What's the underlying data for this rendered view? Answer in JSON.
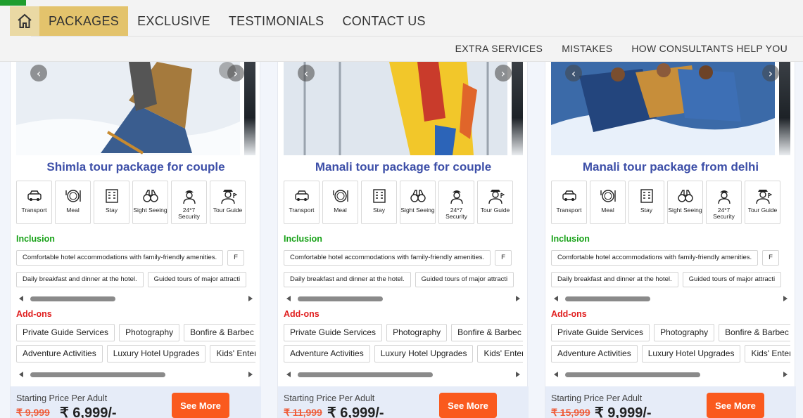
{
  "nav": {
    "home_icon": "home-icon",
    "primary": [
      "PACKAGES",
      "EXCLUSIVE",
      "TESTIMONIALS",
      "CONTACT US"
    ],
    "active": "PACKAGES",
    "secondary": [
      "EXTRA SERVICES",
      "MISTAKES",
      "HOW CONSULTANTS HELP YOU"
    ]
  },
  "colors": {
    "accent_active": "#e3c36c",
    "title_blue": "#3d4fa8",
    "inclusion_green": "#16a116",
    "addons_red": "#e01f1f",
    "cta_orange": "#fa5a1e"
  },
  "features": [
    {
      "icon": "car-icon",
      "label": "Transport"
    },
    {
      "icon": "meal-icon",
      "label": "Meal"
    },
    {
      "icon": "hotel-icon",
      "label": "Stay"
    },
    {
      "icon": "binoculars-icon",
      "label": "Sight Seeing"
    },
    {
      "icon": "guard-icon",
      "label": "24*7 Security"
    },
    {
      "icon": "tour-guide-icon",
      "label": "Tour Guide"
    }
  ],
  "cards": [
    {
      "title": "Shimla tour package for couple",
      "inclusion_heading": "Inclusion",
      "inclusions_row1": [
        "Comfortable hotel accommodations with family-friendly amenities.",
        "F"
      ],
      "inclusions_row2": [
        "Daily breakfast and dinner at the hotel.",
        "Guided tours of major attracti"
      ],
      "addons_heading": "Add-ons",
      "addons_row1": [
        "Private Guide Services",
        "Photography",
        "Bonfire & Barbec"
      ],
      "addons_row2": [
        "Adventure Activities",
        "Luxury Hotel Upgrades",
        "Kids' Enter"
      ],
      "price_label": "Starting Price Per Adult",
      "old_price": "₹ 9,999",
      "new_price": "₹ 6,999/-",
      "cta": "See More"
    },
    {
      "title": "Manali tour package for couple",
      "inclusion_heading": "Inclusion",
      "inclusions_row1": [
        "Comfortable hotel accommodations with family-friendly amenities.",
        "F"
      ],
      "inclusions_row2": [
        "Daily breakfast and dinner at the hotel.",
        "Guided tours of major attracti"
      ],
      "addons_heading": "Add-ons",
      "addons_row1": [
        "Private Guide Services",
        "Photography",
        "Bonfire & Barbec"
      ],
      "addons_row2": [
        "Adventure Activities",
        "Luxury Hotel Upgrades",
        "Kids' Enter"
      ],
      "price_label": "Starting Price Per Adult",
      "old_price": "₹ 11,999",
      "new_price": "₹ 6,999/-",
      "cta": "See More"
    },
    {
      "title": "Manali tour package from delhi",
      "inclusion_heading": "Inclusion",
      "inclusions_row1": [
        "Comfortable hotel accommodations with family-friendly amenities.",
        "F"
      ],
      "inclusions_row2": [
        "Daily breakfast and dinner at the hotel.",
        "Guided tours of major attracti"
      ],
      "addons_heading": "Add-ons",
      "addons_row1": [
        "Private Guide Services",
        "Photography",
        "Bonfire & Barbec"
      ],
      "addons_row2": [
        "Adventure Activities",
        "Luxury Hotel Upgrades",
        "Kids' Enter"
      ],
      "price_label": "Starting Price Per Adult",
      "old_price": "₹ 15,999",
      "new_price": "₹ 9,999/-",
      "cta": "See More"
    }
  ]
}
